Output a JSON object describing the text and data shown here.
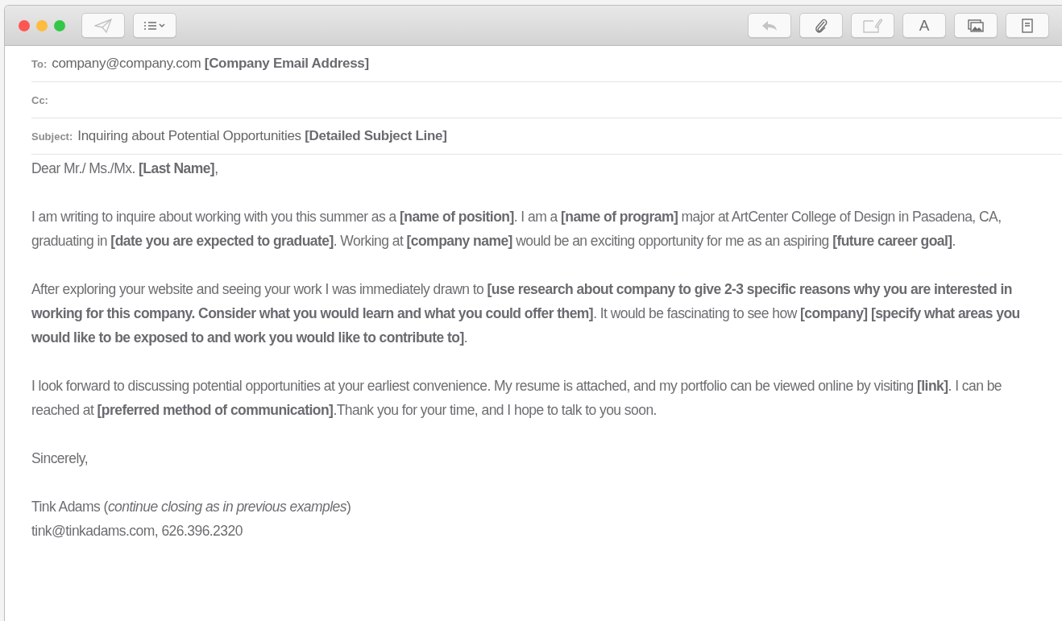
{
  "window": {
    "controls": [
      {
        "color": "#fc5753"
      },
      {
        "color": "#fdbc40"
      },
      {
        "color": "#33c748"
      }
    ]
  },
  "toolbar": {
    "left": [
      {
        "kind": "send",
        "disabled": true
      },
      {
        "kind": "list",
        "disabled": false
      }
    ],
    "right": [
      {
        "kind": "reply",
        "disabled": true
      },
      {
        "kind": "attach",
        "disabled": false
      },
      {
        "kind": "markup",
        "disabled": true
      },
      {
        "kind": "font",
        "label": "A",
        "disabled": false
      },
      {
        "kind": "photo",
        "disabled": false
      },
      {
        "kind": "template",
        "disabled": false
      }
    ]
  },
  "header": [
    {
      "label": "To:",
      "value": "company@company.com **[Company Email Address]**"
    },
    {
      "label": "Cc:"
    },
    {
      "label": "Subject:",
      "value": "Inquiring about Potential Opportunities  **[Detailed Subject Line]**"
    }
  ],
  "body": {
    "greeting": "Dear Mr./ Ms./Mx. **[Last Name]**,",
    "paragraphs": [
      "I am writing to inquire about working with you this summer as a **[name of position]**. I am a **[name of program]** major at ArtCenter College of Design in Pasadena, CA, graduating in **[date you are expected to graduate]**. Working at **[company name]** would be an exciting opportunity for me as an aspiring **[future career goal]**.",
      "After exploring your website and seeing your work I was immediately drawn to **[use research about company to give 2-3 specific reasons why you are interested in working for this company. Consider what you would learn and what you could offer them]**. It would be fascinating to see how **[company] [specify what areas you would like to be exposed to and work you would like to contribute to]**.",
      "I look forward to discussing potential opportunities at your earliest convenience. My resume is attached, and my portfolio can be viewed online by visiting **[link]**. I can be reached at **[preferred method of communication]**.Thank you for your time, and I hope to talk to you soon."
    ],
    "closing": "Sincerely,",
    "signature": [
      "Tink Adams  (*continue closing as in previous examples*)",
      "tink@tinkadams.com, 626.396.2320"
    ]
  }
}
